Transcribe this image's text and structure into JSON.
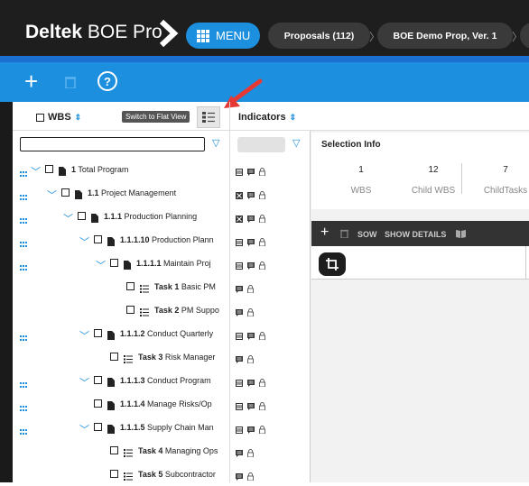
{
  "header": {
    "logo_bold": "Deltek",
    "logo_light": "BOE Pro",
    "menu_label": "MENU",
    "breadcrumbs": [
      "Proposals (112)",
      "BOE Demo Prop, Ver. 1"
    ]
  },
  "colors": {
    "brand_blue": "#1d8fdf",
    "dark": "#1e1e1e",
    "red_arrow": "#e53935"
  },
  "tree": {
    "wbs_header": "WBS",
    "tooltip": "Switch to Flat View",
    "indicators_header": "Indicators",
    "rows": [
      {
        "num": "1",
        "name": "Total Program"
      },
      {
        "num": "1.1",
        "name": "Project Management"
      },
      {
        "num": "1.1.1",
        "name": "Production Planning"
      },
      {
        "num": "1.1.1.10",
        "name": "Production Plann"
      },
      {
        "num": "1.1.1.1",
        "name": "Maintain Proj"
      },
      {
        "num": "Task 1",
        "name": "Basic PM"
      },
      {
        "num": "Task 2",
        "name": "PM Suppo"
      },
      {
        "num": "1.1.1.2",
        "name": "Conduct Quarterly"
      },
      {
        "num": "Task 3",
        "name": "Risk Manager"
      },
      {
        "num": "1.1.1.3",
        "name": "Conduct Program"
      },
      {
        "num": "1.1.1.4",
        "name": "Manage Risks/Op"
      },
      {
        "num": "1.1.1.5",
        "name": "Supply Chain Man"
      },
      {
        "num": "Task 4",
        "name": "Managing Ops"
      },
      {
        "num": "Task 5",
        "name": "Subcontractor"
      }
    ]
  },
  "selection": {
    "title": "Selection Info",
    "stats": [
      {
        "value": "1",
        "label": "WBS"
      },
      {
        "value": "12",
        "label": "Child WBS"
      },
      {
        "value": "7",
        "label": "ChildTasks"
      }
    ]
  },
  "detail_bar": {
    "sow": "SOW",
    "show_details": "SHOW DETAILS"
  }
}
